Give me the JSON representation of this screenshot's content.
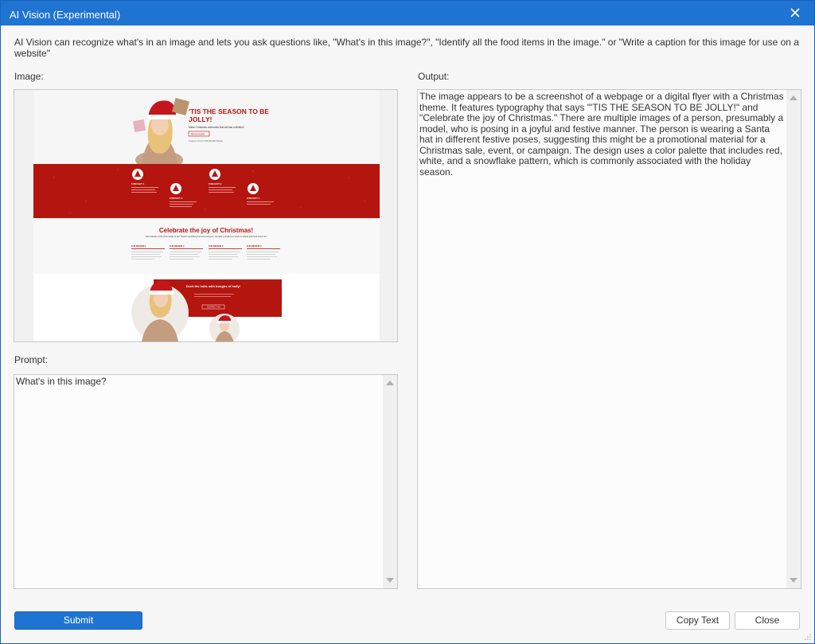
{
  "dialog": {
    "title": "AI Vision (Experimental)",
    "description": "AI Vision can recognize what's in an image and lets you ask questions like, \"What's in this image?\", \"Identify all the food items in the image.\" or \"Write a caption for this image for use on a website\""
  },
  "image_panel": {
    "label": "Image:",
    "preview": {
      "hero_title_line1": "'TIS THE SEASON TO BE",
      "hero_title_line2": "JOLLY!",
      "hero_subtitle": "Make Christmas memories that will last a lifetime!",
      "hero_button": "READ MORE",
      "hero_credit": "Image by Iona for SFSGNN Elite Builder",
      "fun_facts": [
        "FUN FACT 1",
        "FUN FACT 2",
        "FUN FACT 3",
        "FUN FACT 4"
      ],
      "celebrate_title": "Celebrate the joy of Christmas!",
      "celebrate_subtitle": "This website is full of fun things to do! There's something here for everyone. Go take a break from work or school and have some fun!",
      "fun_reviews": [
        "FUN REVIEW 1",
        "FUN REVIEW 2",
        "FUN REVIEW 3",
        "FUN REVIEW 4"
      ],
      "deck_title": "Deck the halls with boughs of holly!",
      "deck_button": "CONTACT US"
    }
  },
  "prompt_panel": {
    "label": "Prompt:",
    "value": "What's in this image?"
  },
  "output_panel": {
    "label": "Output:",
    "value": "The image appears to be a screenshot of a webpage or a digital flyer with a Christmas theme. It features typography that says \"'TIS THE SEASON TO BE JOLLY!\" and \"Celebrate the joy of Christmas.\" There are multiple images of a person, presumably a model, who is posing in a joyful and festive manner. The person is wearing a Santa hat in different festive poses, suggesting this might be a promotional material for a Christmas sale, event, or campaign. The design uses a color palette that includes red, white, and a snowflake pattern, which is commonly associated with the holiday season."
  },
  "buttons": {
    "submit": "Submit",
    "copy_text": "Copy Text",
    "close": "Close"
  },
  "colors": {
    "accent": "#1f74d2",
    "christmas_red": "#b5150f"
  }
}
